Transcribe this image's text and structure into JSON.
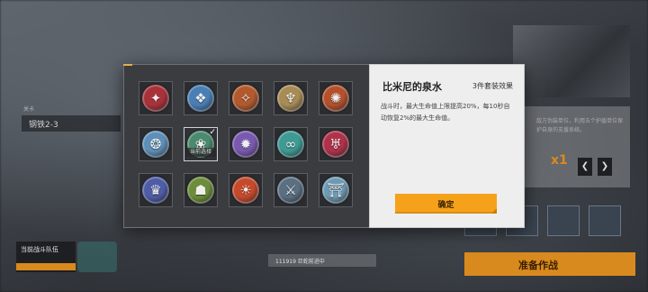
{
  "background": {
    "stage_label": "钢铁2-3",
    "stage_id": "111919 巨蛇前进中",
    "team_label": "当前战斗队伍",
    "start_label": "准备作战",
    "side_text": "敌方伪装单位，利用五个护盾单位保护自身的支援系统。",
    "side_multiplier": "x1"
  },
  "set_grid": {
    "selected_overlay_text": "当前选择",
    "items": [
      {
        "icon": "crimson-phoenix-crest-icon",
        "color": "#a8323a"
      },
      {
        "icon": "azure-wing-crest-icon",
        "color": "#4a7fb5"
      },
      {
        "icon": "ember-blade-crest-icon",
        "color": "#b25a2e"
      },
      {
        "icon": "golden-horn-crest-icon",
        "color": "#a88b55"
      },
      {
        "icon": "flame-mask-crest-icon",
        "color": "#b4512c"
      },
      {
        "icon": "frost-dragon-crest-icon",
        "color": "#5f8fb8"
      },
      {
        "icon": "green-fountain-crest-icon",
        "color": "#4b8a6f",
        "selected": true
      },
      {
        "icon": "violet-beast-crest-icon",
        "color": "#7a5ab0"
      },
      {
        "icon": "teal-infinity-crest-icon",
        "color": "#3f9a93"
      },
      {
        "icon": "ruby-chalice-crest-icon",
        "color": "#b0324a"
      },
      {
        "icon": "indigo-crown-crest-icon",
        "color": "#4f5da6"
      },
      {
        "icon": "olive-helmet-crest-icon",
        "color": "#6d8d3c"
      },
      {
        "icon": "sun-banner-crest-icon",
        "color": "#c54a2b"
      },
      {
        "icon": "steel-trident-crest-icon",
        "color": "#5a6f82"
      },
      {
        "icon": "sky-gate-crest-icon",
        "color": "#6f9ab3"
      }
    ]
  },
  "detail": {
    "set_name": "比米尼的泉水",
    "set_type": "3件套装效果",
    "description": "战斗时，最大生命值上限提高20%，每10秒自动恢复2%的最大生命值。",
    "confirm_label": "确定"
  },
  "colors": {
    "accent": "#f5a21a",
    "panel_dark": "#3a3c40",
    "panel_light": "#eeeeee"
  }
}
